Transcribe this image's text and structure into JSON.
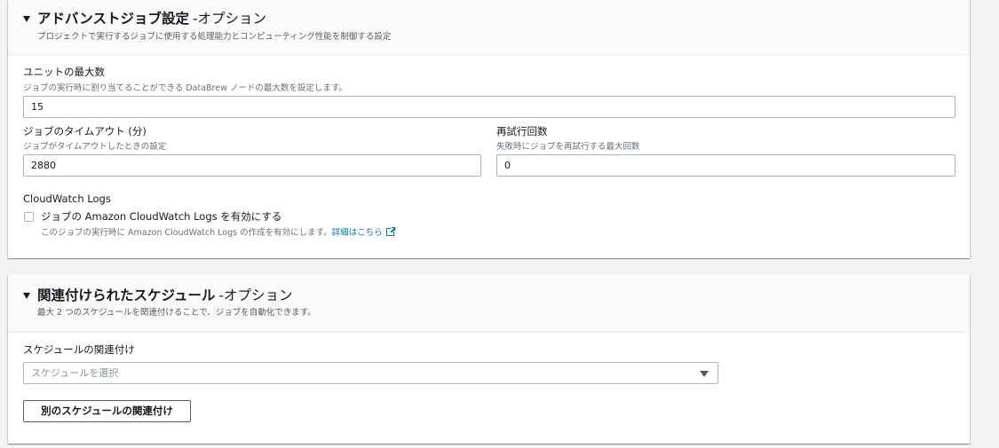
{
  "advanced": {
    "title": "アドバンストジョブ設定",
    "optional": "-オプション",
    "description": "プロジェクトで実行するジョブに使用する処理能力とコンピューティング性能を制御する設定",
    "max_units": {
      "label": "ユニットの最大数",
      "description": "ジョブの実行時に割り当てることができる DataBrew ノードの最大数を設定します。",
      "value": "15"
    },
    "timeout": {
      "label": "ジョブのタイムアウト (分)",
      "description": "ジョブがタイムアウトしたときの設定",
      "value": "2880"
    },
    "retries": {
      "label": "再試行回数",
      "description": "失敗時にジョブを再試行する最大回数",
      "value": "0"
    },
    "cloudwatch": {
      "label": "CloudWatch Logs",
      "checkbox_label": "ジョブの Amazon CloudWatch Logs を有効にする",
      "checkbox_checked": false,
      "description": "このジョブの実行時に Amazon CloudWatch Logs の作成を有効にします。",
      "link_text": "詳細はこちら",
      "link_icon": "external-link-icon"
    }
  },
  "schedules": {
    "title": "関連付けられたスケジュール",
    "optional": "-オプション",
    "description": "最大 2 つのスケジュールを関連付けることで、ジョブを自動化できます。",
    "association": {
      "label": "スケジュールの関連付け",
      "placeholder": "スケジュールを選択"
    },
    "add_button": "別のスケジュールの関連付け"
  },
  "colors": {
    "link": "#0073bb",
    "page_background": "#f2f3f3",
    "header_background": "#fafafa",
    "input_border": "#aab7b8"
  }
}
